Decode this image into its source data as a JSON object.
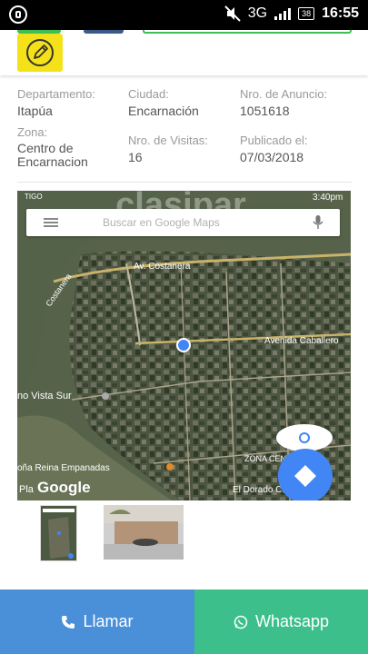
{
  "status_bar": {
    "network": "3G",
    "battery": "38",
    "time": "16:55"
  },
  "listing": {
    "departamento_label": "Departamento:",
    "departamento_value": "Itapúa",
    "ciudad_label": "Ciudad:",
    "ciudad_value": "Encarnación",
    "anuncio_label": "Nro. de Anuncio:",
    "anuncio_value": "1051618",
    "zona_label": "Zona:",
    "zona_value_line1": "Centro de",
    "zona_value_line2": "Encarnacion",
    "visitas_label": "Nro. de Visitas:",
    "visitas_value": "16",
    "publicado_label": "Publicado el:",
    "publicado_value": "07/03/2018"
  },
  "map": {
    "carrier": "TIGO",
    "watermark": "clasipar",
    "clock": "3:40pm",
    "search_placeholder": "Buscar en Google Maps",
    "labels": {
      "costanera": "Av. Costanera",
      "costanera2": "Costanera",
      "avenida": "Avenida Caballero",
      "vista_sur": "no Vista Sur",
      "reina": "oña Reina Empanadas",
      "pla": "Pla",
      "zona_centro": "ZONA CENTRO",
      "dorado": "El Dorado Chamo",
      "google": "Google"
    }
  },
  "footer": {
    "call_label": "Llamar",
    "whatsapp_label": "Whatsapp"
  },
  "colors": {
    "accent_yellow": "#f4e11a",
    "call_blue": "#4a90d9",
    "whatsapp_green": "#3dbf8c"
  }
}
